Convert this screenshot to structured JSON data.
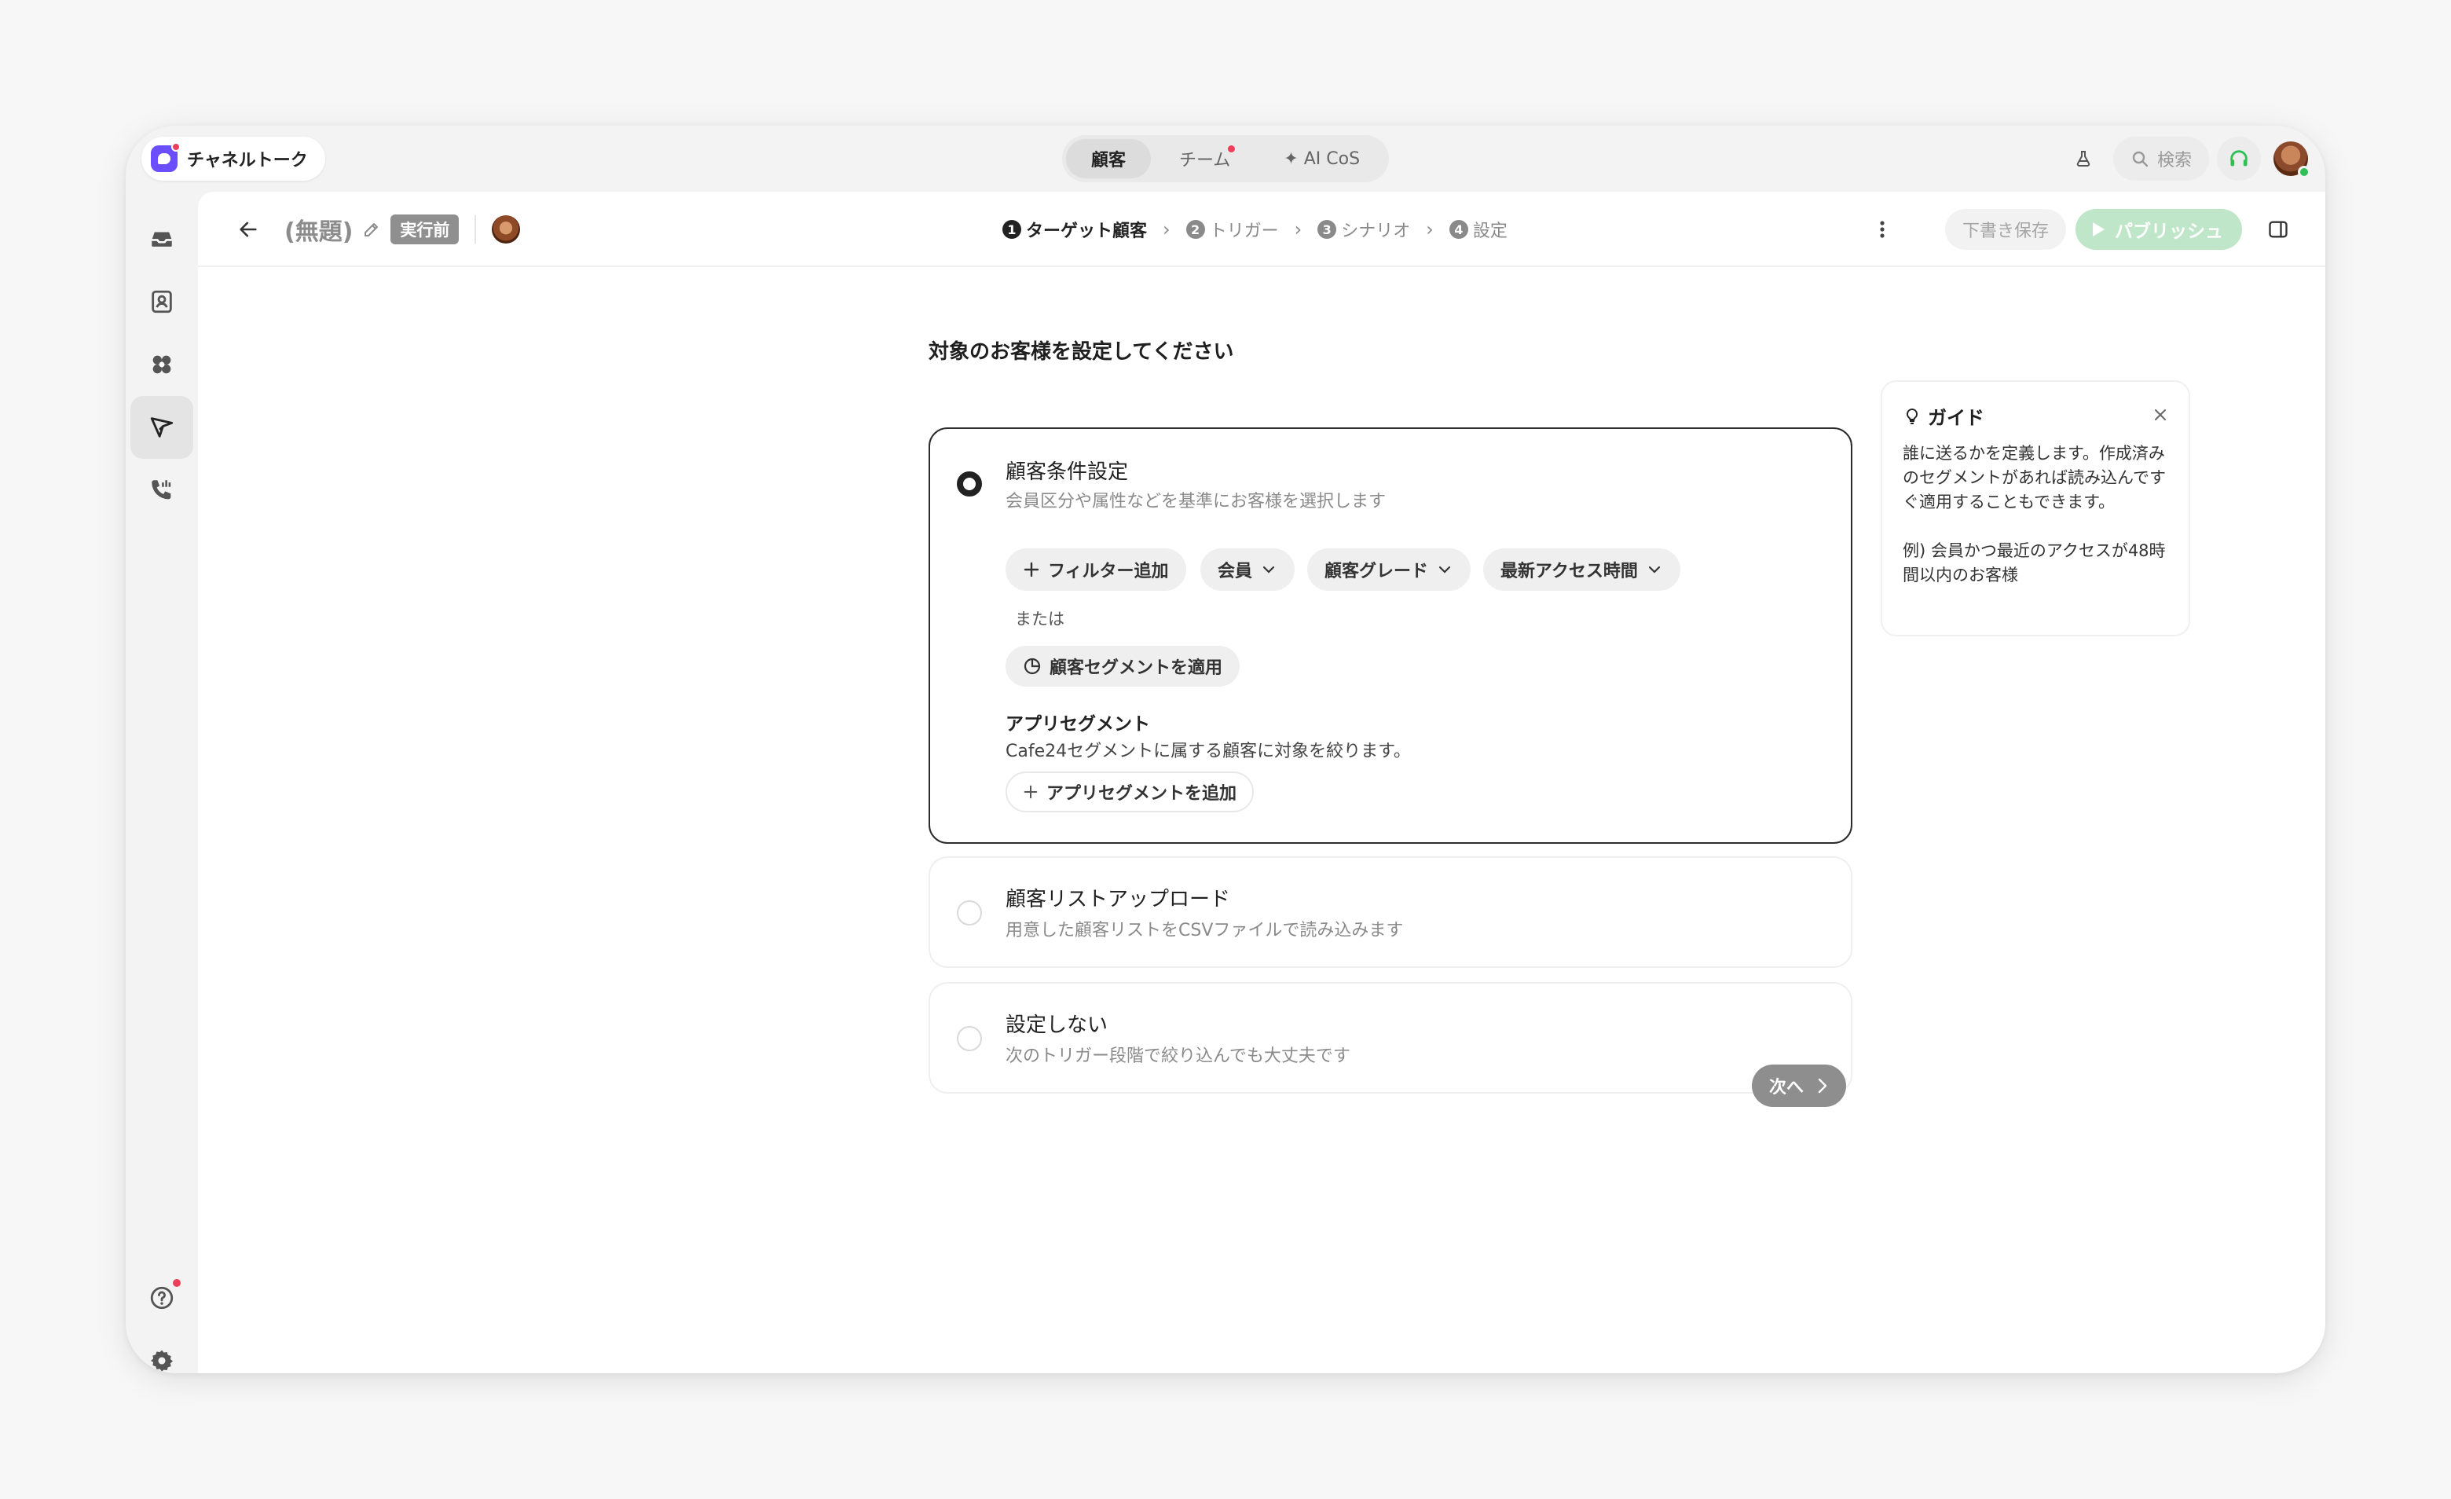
{
  "app": {
    "name": "チャネルトーク"
  },
  "top_tabs": [
    {
      "label": "顧客",
      "active": true
    },
    {
      "label": "チーム",
      "has_notification": true
    },
    {
      "label": "✦ AI CoS"
    }
  ],
  "search": {
    "label": "検索"
  },
  "toolbar": {
    "title": "(無題)",
    "status": "実行前",
    "steps": [
      {
        "num": "1",
        "label": "ターゲット顧客",
        "active": true
      },
      {
        "num": "2",
        "label": "トリガー"
      },
      {
        "num": "3",
        "label": "シナリオ"
      },
      {
        "num": "4",
        "label": "設定"
      }
    ],
    "save_draft": "下書き保存",
    "publish": "パブリッシュ"
  },
  "main": {
    "heading": "対象のお客様を設定してください",
    "options": [
      {
        "title": "顧客条件設定",
        "description": "会員区分や属性などを基準にお客様を選択します",
        "selected": true,
        "filters": {
          "add_filter": "フィルター追加",
          "chips": [
            "会員",
            "顧客グレード",
            "最新アクセス時間"
          ],
          "or_text": "または",
          "apply_segment": "顧客セグメントを適用"
        },
        "app_segment": {
          "title": "アプリセグメント",
          "description": "Cafe24セグメントに属する顧客に対象を絞ります。",
          "add_button": "アプリセグメントを追加"
        }
      },
      {
        "title": "顧客リストアップロード",
        "description": "用意した顧客リストをCSVファイルで読み込みます",
        "selected": false
      },
      {
        "title": "設定しない",
        "description": "次のトリガー段階で絞り込んでも大丈夫です",
        "selected": false
      }
    ],
    "next_button": "次へ"
  },
  "guide": {
    "title": "ガイド",
    "body": "誰に送るかを定義します。作成済みのセグメントがあれば読み込んですぐ適用することもできます。",
    "example": "例) 会員かつ最近のアクセスが48時間以内のお客様"
  },
  "colors": {
    "accent_purple": "#6b4eff",
    "publish_green": "#bfe6c9",
    "notification_red": "#ef3e5a",
    "online_green": "#2fbf55"
  }
}
